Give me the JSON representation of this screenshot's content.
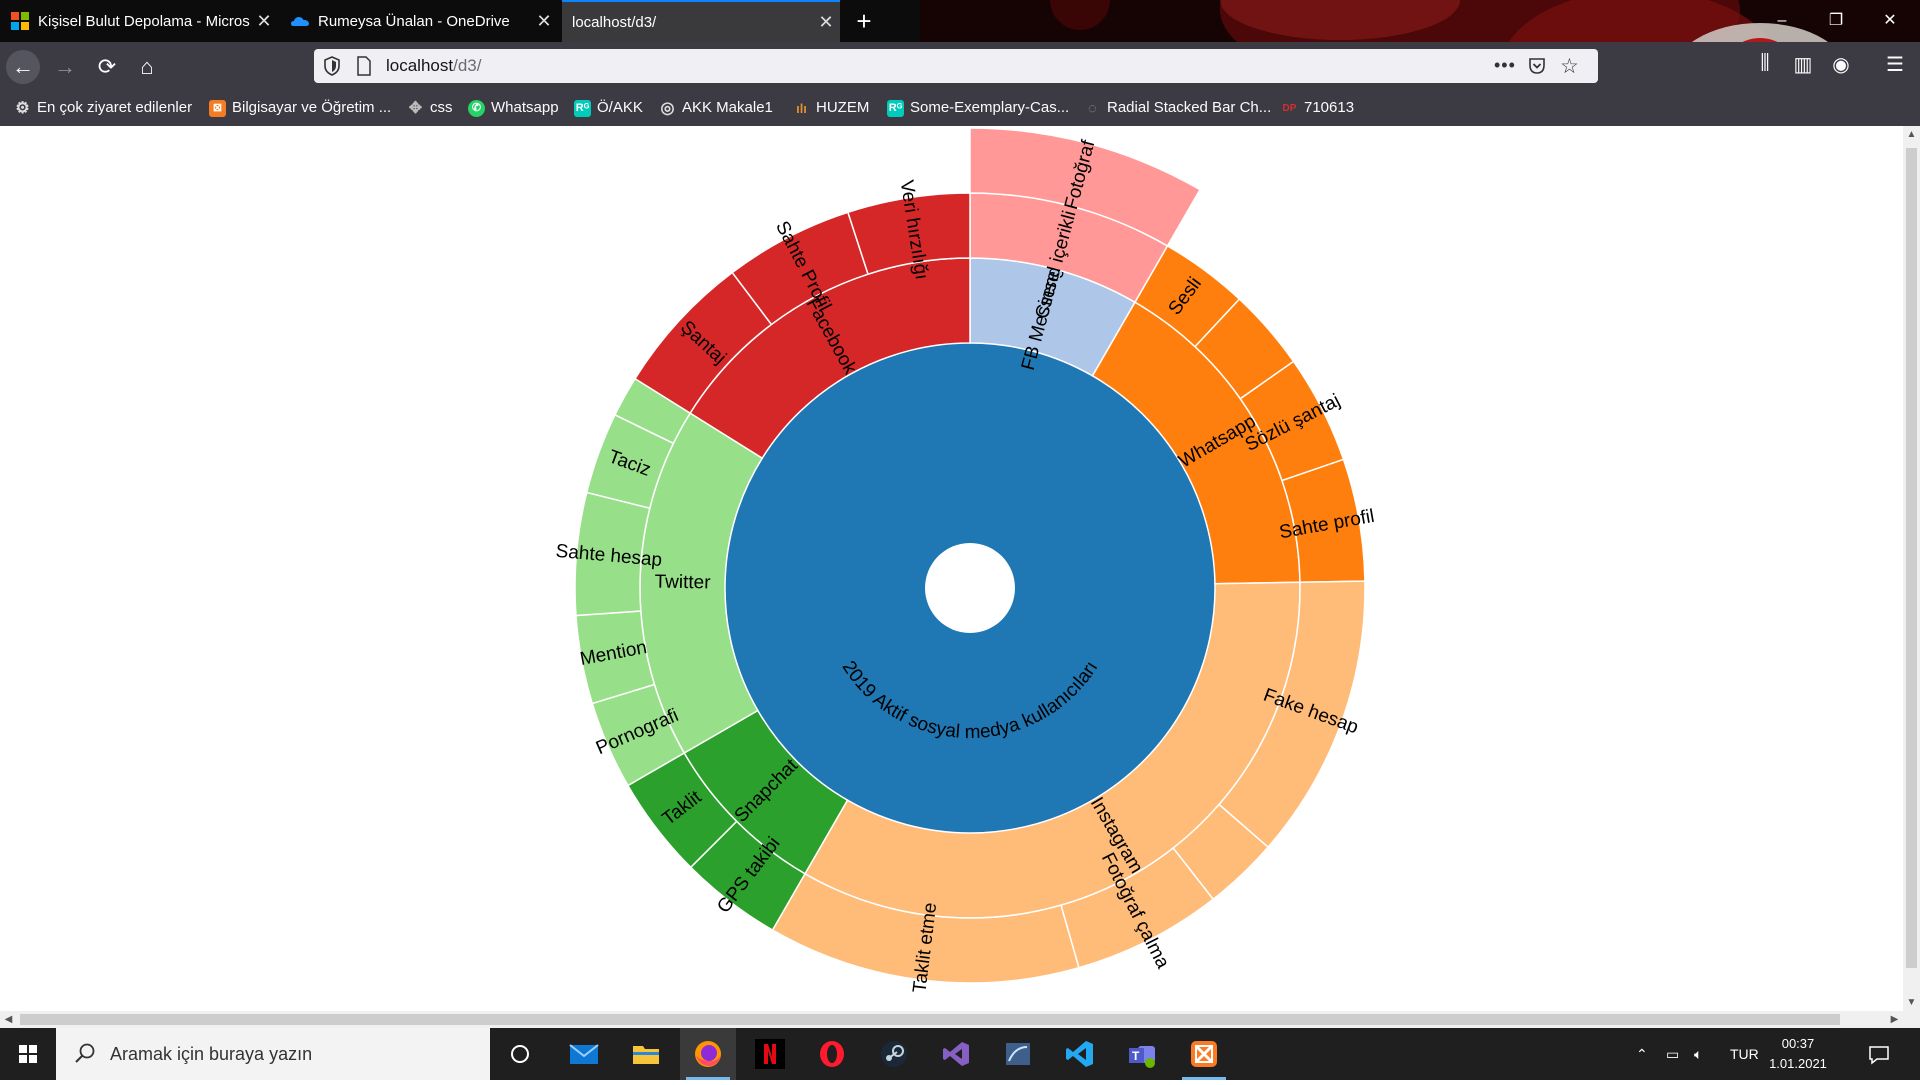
{
  "browser": {
    "tabs": [
      {
        "title": "Kişisel Bulut Depolama - Microsoft",
        "active": false
      },
      {
        "title": "Rumeysa Ünalan - OneDrive",
        "active": false
      },
      {
        "title": "localhost/d3/",
        "active": true
      }
    ],
    "new_tab_label": "+",
    "window_controls": {
      "minimize": "–",
      "maximize": "❐",
      "close": "✕"
    },
    "nav": {
      "back": "←",
      "forward": "→",
      "reload": "⟳",
      "home": "⌂"
    },
    "url": {
      "host": "localhost",
      "path": "/d3/",
      "more": "•••",
      "star": "☆"
    },
    "toolbar_icons": {
      "library": "⫼",
      "sidebar": "▥",
      "account": "◉",
      "menu": "☰"
    },
    "bookmarks": [
      {
        "label": "En çok ziyaret edilenler",
        "icon": "gear-icon",
        "color": "#cfcfcf"
      },
      {
        "label": "Bilgisayar ve Öğretim ...",
        "icon": "xampp-icon",
        "color": "#f57c22"
      },
      {
        "label": "css",
        "icon": "puzzle-icon",
        "color": "#aaaaaa"
      },
      {
        "label": "Whatsapp",
        "icon": "whatsapp-icon",
        "color": "#25d366"
      },
      {
        "label": "Ö/AKK",
        "icon": "researchgate-icon",
        "color": "#00ccbb"
      },
      {
        "label": "AKK Makale1",
        "icon": "globe-icon",
        "color": "#cfcfcf"
      },
      {
        "label": "HUZEM",
        "icon": "huzem-icon",
        "color": "#e09030"
      },
      {
        "label": "Some-Exemplary-Cas...",
        "icon": "researchgate-icon",
        "color": "#00ccbb"
      },
      {
        "label": "Radial Stacked Bar Ch...",
        "icon": "observable-icon",
        "color": "#888888"
      },
      {
        "label": "710613",
        "icon": "dp-icon",
        "color": "#d0312d"
      }
    ]
  },
  "chart_data": {
    "type": "sunburst",
    "root": "2019 Aktif sosyal medya kullanıcıları",
    "platforms": [
      {
        "name": "FB Messenger",
        "color": "#aec7e8",
        "start_deg": 0,
        "end_deg": 30,
        "children": [
          {
            "name": "Cinsel içerikli mesaj",
            "start_deg": 0,
            "end_deg": 30,
            "children": [
              {
                "name": "Fotoğraf",
                "start_deg": 0,
                "end_deg": 30
              }
            ]
          }
        ]
      },
      {
        "name": "Whatsapp",
        "color": "#ff7f0e",
        "start_deg": 30,
        "end_deg": 89,
        "children": [
          {
            "name": "Sesli",
            "start_deg": 30,
            "end_deg": 43
          },
          {
            "name": "",
            "start_deg": 43,
            "end_deg": 55
          },
          {
            "name": "Sözlü şantaj",
            "start_deg": 55,
            "end_deg": 71
          },
          {
            "name": "Sahte profil",
            "start_deg": 71,
            "end_deg": 89
          }
        ]
      },
      {
        "name": "Instagram",
        "color": "#ffbb78",
        "start_deg": 89,
        "end_deg": 210,
        "children": [
          {
            "name": "Fake hesap",
            "start_deg": 89,
            "end_deg": 131
          },
          {
            "name": "",
            "start_deg": 131,
            "end_deg": 142
          },
          {
            "name": "Fotoğraf çalma",
            "start_deg": 142,
            "end_deg": 164
          },
          {
            "name": "Taklit etme",
            "start_deg": 164,
            "end_deg": 210
          }
        ]
      },
      {
        "name": "Snapchat",
        "color": "#2ca02c",
        "start_deg": 210,
        "end_deg": 240,
        "children": [
          {
            "name": "GPS takibi",
            "start_deg": 210,
            "end_deg": 225
          },
          {
            "name": "Taklit",
            "start_deg": 225,
            "end_deg": 240
          }
        ]
      },
      {
        "name": "Twitter",
        "color": "#98df8a",
        "start_deg": 240,
        "end_deg": 302,
        "children": [
          {
            "name": "Pornografi",
            "start_deg": 240,
            "end_deg": 253
          },
          {
            "name": "Mention",
            "start_deg": 253,
            "end_deg": 266
          },
          {
            "name": "Sahte hesap",
            "start_deg": 266,
            "end_deg": 284
          },
          {
            "name": "Taciz",
            "start_deg": 284,
            "end_deg": 296
          },
          {
            "name": "",
            "start_deg": 296,
            "end_deg": 302
          }
        ]
      },
      {
        "name": "Facebook",
        "color": "#d62728",
        "start_deg": 302,
        "end_deg": 360,
        "children": [
          {
            "name": "Şantaj",
            "start_deg": 302,
            "end_deg": 323
          },
          {
            "name": "Sahte Profil",
            "start_deg": 323,
            "end_deg": 342
          },
          {
            "name": "Veri hırzılığı",
            "start_deg": 342,
            "end_deg": 360
          }
        ]
      }
    ],
    "colors": {
      "root": "#1f77b4",
      "fb_messenger_l2": "#ff9896"
    }
  },
  "taskbar": {
    "search_placeholder": "Aramak için buraya yazın",
    "apps": [
      "task-view-icon",
      "mail-icon",
      "file-explorer-icon",
      "firefox-icon",
      "netflix-icon",
      "opera-icon",
      "steam-icon",
      "visual-studio-icon",
      "sql-server-icon",
      "vscode-icon",
      "teams-icon",
      "xampp-icon"
    ],
    "language": "TUR",
    "time": "00:37",
    "date": "1.01.2021"
  }
}
